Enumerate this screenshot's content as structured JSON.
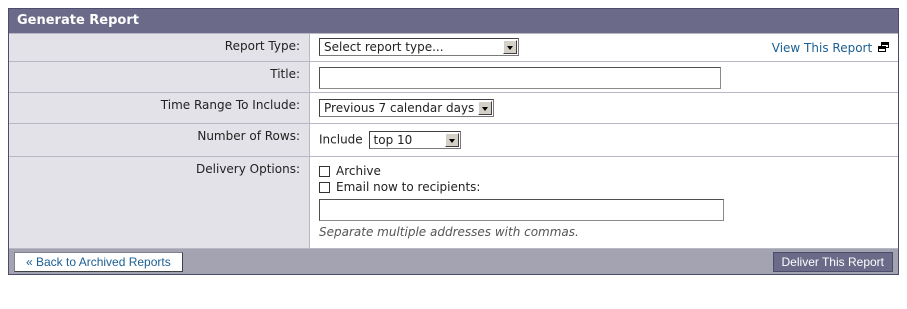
{
  "panel": {
    "title": "Generate Report"
  },
  "fields": {
    "report_type": {
      "label": "Report Type:",
      "selected": "Select report type..."
    },
    "view_link": "View This Report",
    "title": {
      "label": "Title:",
      "value": ""
    },
    "time_range": {
      "label": "Time Range To Include:",
      "selected": "Previous 7 calendar days"
    },
    "rows": {
      "label": "Number of Rows:",
      "prefix": "Include",
      "selected": "top 10"
    },
    "delivery": {
      "label": "Delivery Options:",
      "archive_label": "Archive",
      "archive_checked": false,
      "email_label": "Email now to recipients:",
      "email_checked": false,
      "recipients_value": "",
      "hint": "Separate multiple addresses with commas."
    }
  },
  "footer": {
    "back_label": "« Back to Archived Reports",
    "deliver_label": "Deliver This Report"
  },
  "icons": {
    "view_link": "external-window-icon",
    "select_arrow": "chevron-down-icon"
  }
}
